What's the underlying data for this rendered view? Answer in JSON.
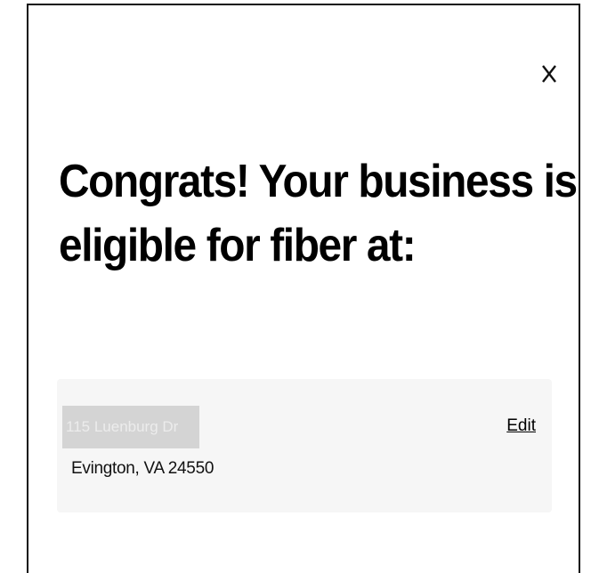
{
  "modal": {
    "close_icon": "close-icon",
    "headline_line1": "Congrats! Your business is",
    "headline_line2": "eligible for fiber at:",
    "address": {
      "street": "115 Luenburg Dr",
      "city_state_zip": "Evington, VA 24550",
      "edit_label": "Edit"
    }
  }
}
